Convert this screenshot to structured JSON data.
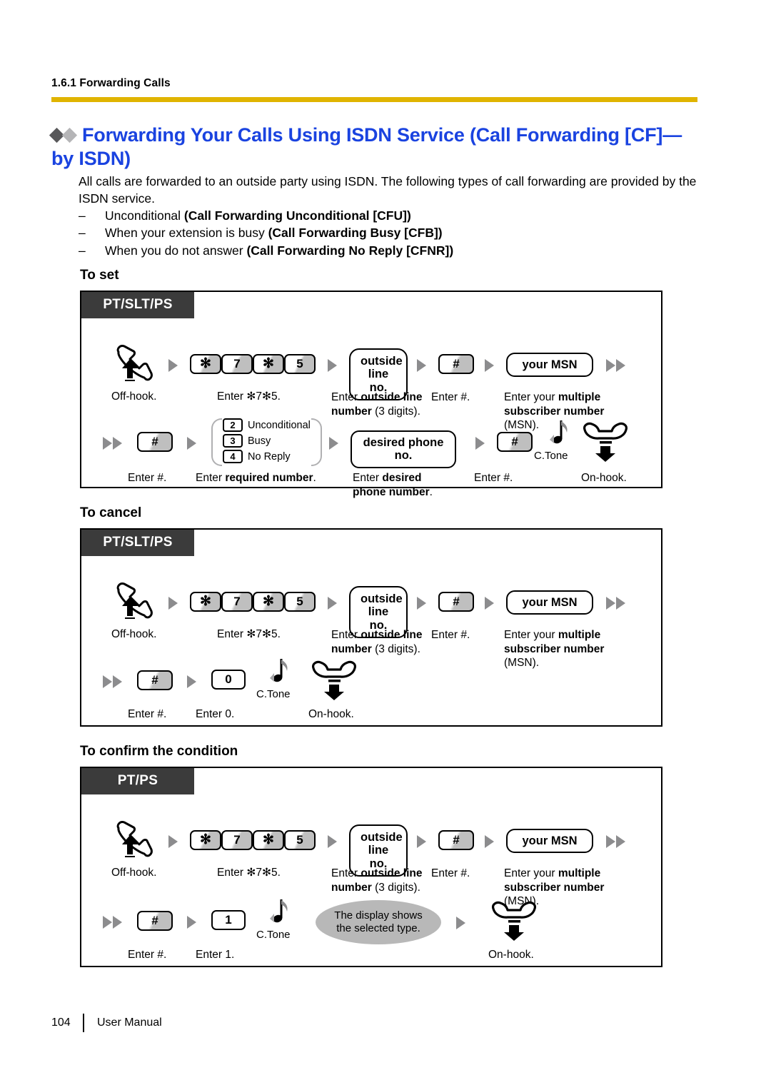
{
  "header": {
    "running_head": "1.6.1 Forwarding Calls",
    "rule_color": "#e0b400"
  },
  "title": {
    "text": "Forwarding Your Calls Using ISDN Service (Call Forwarding [CF]—by ISDN)",
    "color": "#1a43e0"
  },
  "intro": {
    "paragraph": "All calls are forwarded to an outside party using ISDN. The following types of call forwarding are provided by the ISDN service.",
    "items": [
      {
        "dash": "–",
        "plain": "Unconditional ",
        "bold": "(Call Forwarding Unconditional [CFU])"
      },
      {
        "dash": "–",
        "plain": "When your extension is busy ",
        "bold": "(Call Forwarding Busy [CFB])"
      },
      {
        "dash": "–",
        "plain": "When you do not answer ",
        "bold": "(Call Forwarding No Reply [CFNR])"
      }
    ]
  },
  "sections": [
    {
      "heading": "To set",
      "tab": "PT/SLT/PS"
    },
    {
      "heading": "To cancel",
      "tab": "PT/SLT/PS"
    },
    {
      "heading": "To confirm the condition",
      "tab": "PT/PS"
    }
  ],
  "labels": {
    "off_hook": "Off-hook.",
    "on_hook": "On-hook.",
    "enter_star7star5": "Enter  ✻7✻5.",
    "enter_hash": "Enter #.",
    "enter_0": "Enter 0.",
    "enter_1": "Enter 1.",
    "enter_outside_line_1": "Enter ",
    "enter_outside_line_bold": "outside line number",
    "enter_outside_line_2": " (3 digits).",
    "enter_msn_1": "Enter your ",
    "enter_msn_bold": "multiple subscriber number",
    "enter_msn_2": " (MSN).",
    "enter_required_1": "Enter ",
    "enter_required_bold": "required number",
    "enter_required_2": ".",
    "enter_desired_1": "Enter ",
    "enter_desired_bold": "desired phone number",
    "enter_desired_2": ".",
    "c_tone": "C.Tone"
  },
  "keys": {
    "star": "✻",
    "seven": "7",
    "five": "5",
    "hash": "#",
    "zero": "0",
    "one": "1",
    "two": "2",
    "three": "3",
    "four": "4"
  },
  "pills": {
    "outside_line_l1": "outside",
    "outside_line_l2": "line no.",
    "your_msn": "your MSN",
    "desired_phone_no": "desired phone no."
  },
  "options": [
    {
      "key": "2",
      "label": "Unconditional"
    },
    {
      "key": "3",
      "label": "Busy"
    },
    {
      "key": "4",
      "label": "No Reply"
    }
  ],
  "display_note": {
    "line1": "The display shows",
    "line2": "the selected type."
  },
  "footer": {
    "page_number": "104",
    "manual_label": "User Manual"
  }
}
